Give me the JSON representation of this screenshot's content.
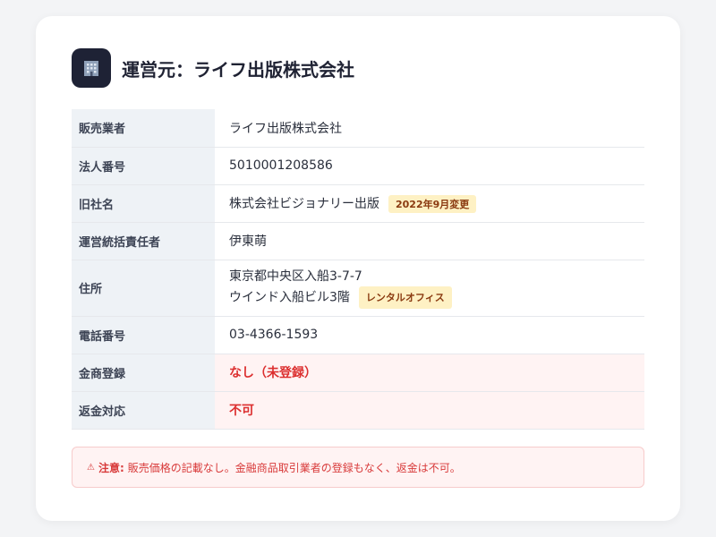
{
  "header": {
    "icon": "office-building-icon",
    "title": "運営元：ライフ出版株式会社"
  },
  "rows": [
    {
      "label": "販売業者",
      "value": "ライフ出版株式会社"
    },
    {
      "label": "法人番号",
      "value": "5010001208586"
    },
    {
      "label": "旧社名",
      "value": "株式会社ビジョナリー出版",
      "badge": "2022年9月変更"
    },
    {
      "label": "運営統括責任者",
      "value": "伊東萌"
    },
    {
      "label": "住所",
      "value_lines": [
        "東京都中央区入船3-7-7",
        "ウインド入船ビル3階"
      ],
      "badge": "レンタルオフィス"
    },
    {
      "label": "電話番号",
      "value": "03-4366-1593"
    },
    {
      "label": "金商登録",
      "value": "なし（未登録）"
    },
    {
      "label": "返金対応",
      "value": "不可"
    }
  ],
  "notice": {
    "icon": "warning-icon",
    "label": "注意:",
    "text": "販売価格の記載なし。金融商品取引業者の登録もなく、返金は不可。"
  },
  "colors": {
    "warn_red": "#dc2f2f",
    "badge_bg": "#fef1c4",
    "label_bg": "#eef2f6",
    "logo_bg": "#1e2235"
  }
}
